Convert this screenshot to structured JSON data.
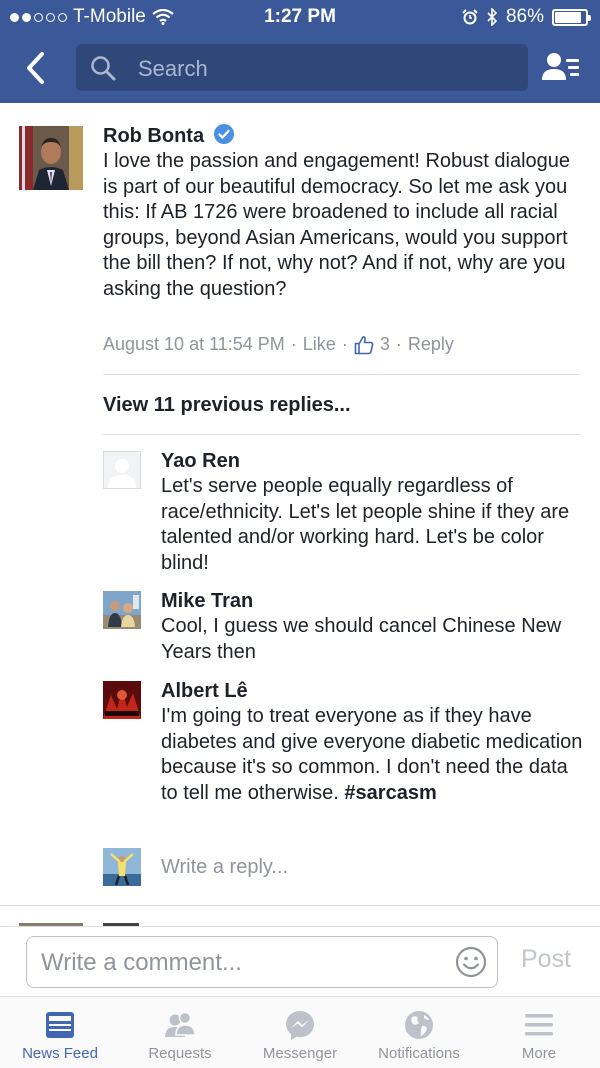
{
  "status_bar": {
    "carrier": "T-Mobile",
    "time": "1:27 PM",
    "battery": "86%",
    "battery_level": 0.86
  },
  "header": {
    "search_placeholder": "Search"
  },
  "post": {
    "author": "Rob Bonta",
    "verified": true,
    "text": "I love the passion and engagement!  Robust dialogue is part of our beautiful democracy. So let me ask you this:  If AB 1726 were broadened to include all racial groups, beyond Asian Americans, would you support the bill then? If not, why not?  And if not, why are you asking the question?",
    "timestamp": "August 10 at 11:54 PM",
    "like_label": "Like",
    "like_count": "3",
    "reply_label": "Reply",
    "sep": "·"
  },
  "view_previous": "View 11 previous replies...",
  "replies": [
    {
      "author": "Yao Ren",
      "text": "Let's serve people equally regardless of race/ethnicity. Let's let people shine if they are talented and/or working hard. Let's be color blind!"
    },
    {
      "author": "Mike Tran",
      "text": "Cool, I guess we should cancel Chinese New Years then"
    },
    {
      "author": "Albert Lê",
      "text_plain": "I'm going to treat everyone as if they have diabetes and give everyone diabetic medication because it's so common. I don't need the data to tell me otherwise. ",
      "hashtag": "#sarcasm"
    }
  ],
  "write_reply_placeholder": "Write a reply...",
  "comment_bar": {
    "placeholder": "Write a comment...",
    "post_label": "Post"
  },
  "tabs": [
    {
      "label": "News Feed",
      "icon": "news-feed-icon",
      "active": true
    },
    {
      "label": "Requests",
      "icon": "friend-requests-icon",
      "active": false
    },
    {
      "label": "Messenger",
      "icon": "messenger-icon",
      "active": false
    },
    {
      "label": "Notifications",
      "icon": "globe-icon",
      "active": false
    },
    {
      "label": "More",
      "icon": "hamburger-icon",
      "active": false
    }
  ],
  "colors": {
    "brand": "#3b5998",
    "link": "#4267b2",
    "verified": "#4a90e2",
    "muted": "#90949c"
  }
}
